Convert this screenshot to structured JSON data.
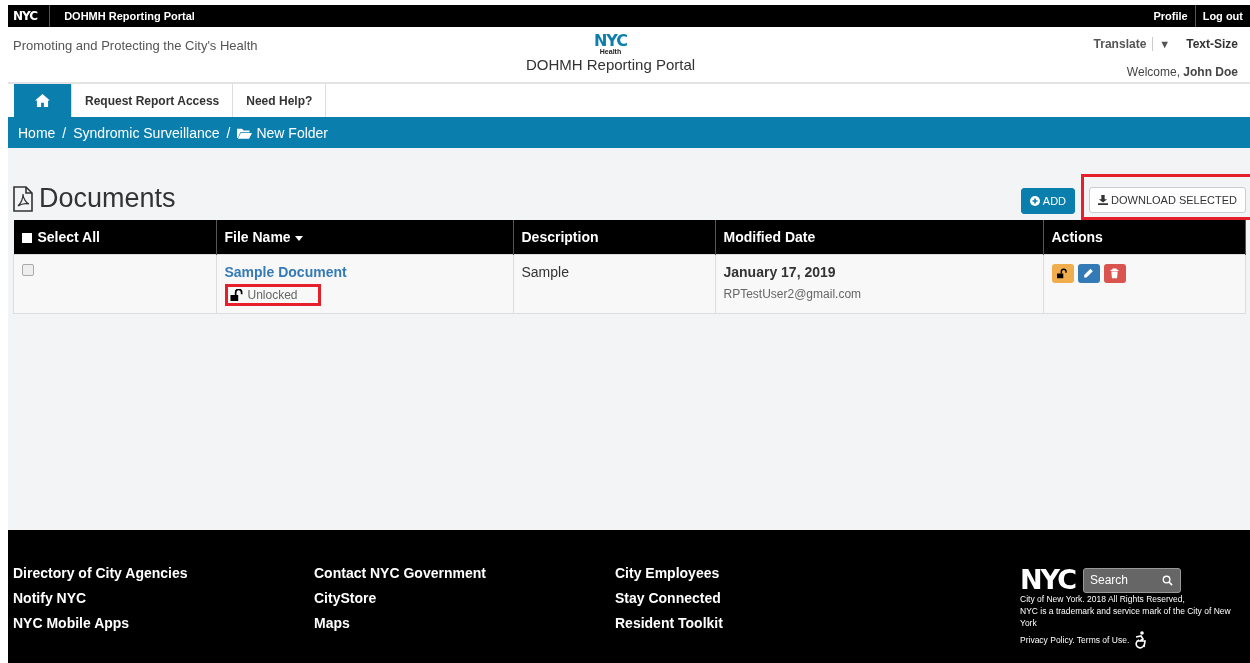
{
  "top_bar": {
    "logo": "NYC",
    "title": "DOHMH Reporting Portal",
    "links": [
      "Profile",
      "Log out"
    ]
  },
  "header": {
    "tagline": "Promoting and Protecting the City's Health",
    "logo": "NYC",
    "logo_sub": "Health",
    "portal_name": "DOHMH Reporting Portal",
    "translate": "Translate",
    "translate_caret": "▼",
    "text_size": "Text-Size",
    "welcome": "Welcome,",
    "user": "John Doe"
  },
  "nav_tabs": [
    {
      "kind": "home",
      "selected": true
    },
    {
      "kind": "text",
      "label": "Request Report Access",
      "selected": false
    },
    {
      "kind": "text",
      "label": "Need Help?",
      "selected": false
    }
  ],
  "breadcrumb": {
    "separator": "/",
    "items": [
      {
        "kind": "text",
        "label": "Home"
      },
      {
        "kind": "text",
        "label": "Syndromic Surveillance"
      },
      {
        "kind": "folder",
        "label": "New Folder"
      }
    ]
  },
  "page_title": "Documents",
  "buttons": [
    {
      "kind": "add",
      "label": "ADD",
      "highlighted": false
    },
    {
      "kind": "download",
      "label": "DOWNLOAD SELECTED",
      "highlighted": true
    }
  ],
  "table": {
    "select_all": {
      "label": "Select All",
      "checked": false
    },
    "columns": [
      {
        "label": "File Name",
        "sorted": true
      },
      {
        "label": "Description",
        "sorted": false
      },
      {
        "label": "Modified Date",
        "sorted": false
      },
      {
        "label": "Actions",
        "sorted": false
      }
    ],
    "rows": [
      {
        "selected": false,
        "file_name": "Sample Document",
        "locked": false,
        "lock_status": "Unlocked",
        "status_highlighted": true,
        "description": "Sample",
        "modified_date": "January 17, 2019",
        "modified_by": "RPTestUser2@gmail.com",
        "actions": [
          {
            "kind": "unlock"
          },
          {
            "kind": "edit"
          },
          {
            "kind": "delete"
          }
        ]
      }
    ]
  },
  "footer": {
    "columns": [
      [
        "Directory of City Agencies",
        "Notify NYC",
        "NYC Mobile Apps"
      ],
      [
        "Contact NYC Government",
        "CityStore",
        "Maps"
      ],
      [
        "City Employees",
        "Stay Connected",
        "Resident Toolkit"
      ]
    ],
    "logo": "NYC",
    "search": {
      "placeholder": "Search"
    },
    "legal": [
      "City of New York. 2018 All Rights Reserved,",
      "NYC is a trademark and service mark of the City of New York"
    ],
    "policy": "Privacy Policy. Terms of Use."
  }
}
